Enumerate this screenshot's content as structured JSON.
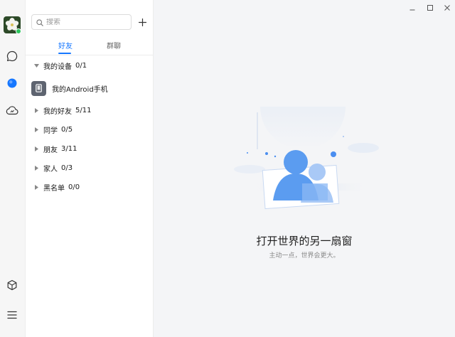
{
  "search": {
    "placeholder": "搜索"
  },
  "tabs": [
    {
      "label": "好友",
      "active": true
    },
    {
      "label": "群聊",
      "active": false
    }
  ],
  "groups": [
    {
      "label": "我的设备",
      "count": "0/1",
      "expanded": true
    },
    {
      "label": "我的好友",
      "count": "5/11",
      "expanded": false
    },
    {
      "label": "同学",
      "count": "0/5",
      "expanded": false
    },
    {
      "label": "朋友",
      "count": "3/11",
      "expanded": false
    },
    {
      "label": "家人",
      "count": "0/3",
      "expanded": false
    },
    {
      "label": "黑名单",
      "count": "0/0",
      "expanded": false
    }
  ],
  "devices": [
    {
      "label": "我的Android手机"
    }
  ],
  "main": {
    "title": "打开世界的另一扇窗",
    "subtitle": "主动一点，世界会更大。"
  },
  "colors": {
    "accent": "#1677ff",
    "online": "#2bc65c",
    "illustration": "#5b9cf0"
  },
  "icons": {
    "rail": [
      "avatar",
      "message-icon",
      "contacts-icon",
      "cloud-icon",
      "cube-icon",
      "menu-icon"
    ],
    "window": [
      "minimize-icon",
      "maximize-icon",
      "close-icon"
    ]
  }
}
